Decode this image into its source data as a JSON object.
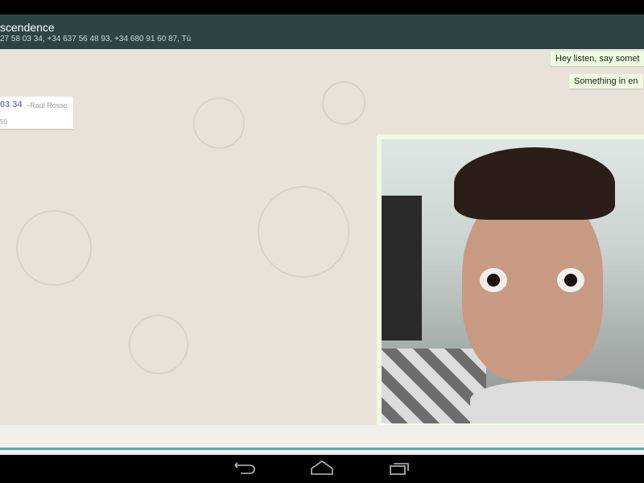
{
  "header": {
    "title": "scendence",
    "subtitle": "27 58 03 34, +34 637 56 48 93, +34 680 91 60 87, Tú"
  },
  "messages": {
    "incoming": {
      "number": "03 34",
      "sender": "~Raúl Rosso",
      "time": "50"
    },
    "outgoing": [
      {
        "text": "Hey listen, say somet"
      },
      {
        "text": "Something in en"
      }
    ],
    "photo": {
      "type": "image",
      "subject": "selfie"
    }
  },
  "colors": {
    "header": "#2e4444",
    "accent": "#5aa9b6",
    "outgoing_bubble": "#eefbe0",
    "wallpaper": "#e8e2d8"
  },
  "navbar": {
    "icons": [
      "back-icon",
      "home-icon",
      "recent-apps-icon"
    ]
  }
}
